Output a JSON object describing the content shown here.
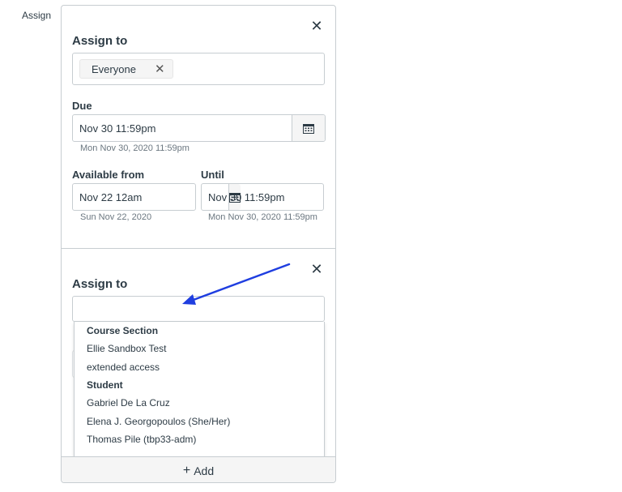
{
  "side_label": "Assign",
  "card1": {
    "title": "Assign to",
    "chip": "Everyone",
    "due": {
      "label": "Due",
      "value": "Nov 30 11:59pm",
      "hint": "Mon Nov 30, 2020 11:59pm"
    },
    "available_from": {
      "label": "Available from",
      "value": "Nov 22 12am",
      "hint": "Sun Nov 22, 2020"
    },
    "until": {
      "label": "Until",
      "value": "Nov 30 11:59pm",
      "hint": "Mon Nov 30, 2020 11:59pm"
    }
  },
  "card2": {
    "title": "Assign to",
    "search_value": "",
    "dropdown": {
      "group1_label": "Course Section",
      "sections": [
        "Ellie Sandbox Test",
        "extended access"
      ],
      "group2_label": "Student",
      "students": [
        "Gabriel De La Cruz",
        "Elena J. Georgopoulos (She/Her)",
        "Thomas Pile (tbp33-adm)"
      ]
    }
  },
  "add_label": "Add",
  "icons": {
    "close": "close-icon",
    "calendar": "calendar-icon",
    "plus": "plus-icon",
    "arrow": "annotation-arrow"
  },
  "colors": {
    "arrow": "#1f3ee0",
    "text": "#2d3b45",
    "border": "#c7cdd1"
  }
}
